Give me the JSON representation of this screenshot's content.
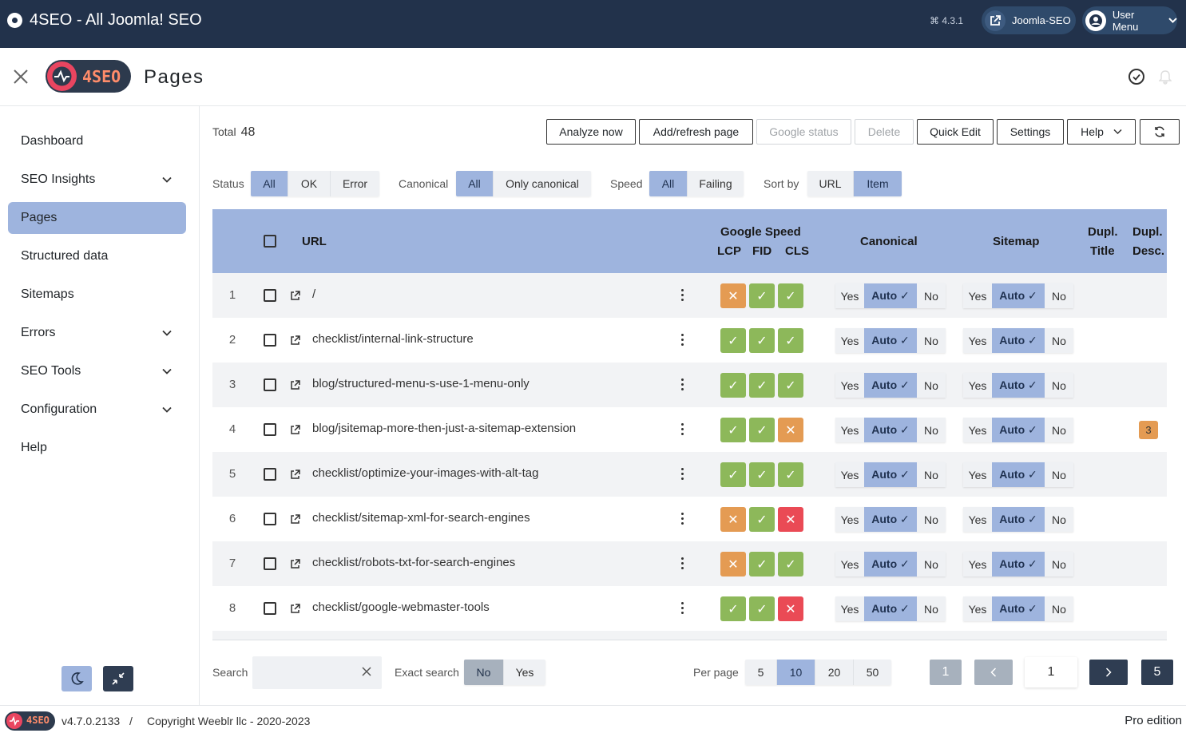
{
  "topbar": {
    "title": "4SEO - All Joomla! SEO",
    "version": "4.3.1",
    "site_button": "Joomla-SEO",
    "user_menu": "User Menu"
  },
  "header": {
    "page_title": "Pages",
    "logo_text": "4SEO"
  },
  "sidebar": {
    "items": [
      {
        "label": "Dashboard",
        "has_chevron": false,
        "active": false
      },
      {
        "label": "SEO Insights",
        "has_chevron": true,
        "active": false
      },
      {
        "label": "Pages",
        "has_chevron": false,
        "active": true
      },
      {
        "label": "Structured data",
        "has_chevron": false,
        "active": false
      },
      {
        "label": "Sitemaps",
        "has_chevron": false,
        "active": false
      },
      {
        "label": "Errors",
        "has_chevron": true,
        "active": false
      },
      {
        "label": "SEO Tools",
        "has_chevron": true,
        "active": false
      },
      {
        "label": "Configuration",
        "has_chevron": true,
        "active": false
      },
      {
        "label": "Help",
        "has_chevron": false,
        "active": false
      }
    ]
  },
  "toolbar": {
    "total_label": "Total",
    "total_value": "48",
    "analyze": "Analyze now",
    "add_refresh": "Add/refresh page",
    "google_status": "Google status",
    "delete": "Delete",
    "quick_edit": "Quick Edit",
    "settings": "Settings",
    "help": "Help"
  },
  "filters": {
    "status_label": "Status",
    "status_all": "All",
    "status_ok": "OK",
    "status_error": "Error",
    "canonical_label": "Canonical",
    "canonical_all": "All",
    "canonical_only": "Only canonical",
    "speed_label": "Speed",
    "speed_all": "All",
    "speed_failing": "Failing",
    "sort_label": "Sort by",
    "sort_url": "URL",
    "sort_item": "Item"
  },
  "table": {
    "headers": {
      "url": "URL",
      "google_speed": "Google Speed",
      "lcp": "LCP",
      "fid": "FID",
      "cls": "CLS",
      "canonical": "Canonical",
      "sitemap": "Sitemap",
      "dupl_title_1": "Dupl.",
      "dupl_title_2": "Title",
      "dupl_desc_1": "Dupl.",
      "dupl_desc_2": "Desc."
    },
    "toggle_yes": "Yes",
    "toggle_auto": "Auto ✓",
    "toggle_no": "No",
    "rows": [
      {
        "num": "1",
        "url": "/",
        "speed": [
          "warn",
          "ok",
          "ok"
        ],
        "dupl_desc": ""
      },
      {
        "num": "2",
        "url": "checklist/internal-link-structure",
        "speed": [
          "ok",
          "ok",
          "ok"
        ],
        "dupl_desc": ""
      },
      {
        "num": "3",
        "url": "blog/structured-menu-s-use-1-menu-only",
        "speed": [
          "ok",
          "ok",
          "ok"
        ],
        "dupl_desc": ""
      },
      {
        "num": "4",
        "url": "blog/jsitemap-more-then-just-a-sitemap-extension",
        "speed": [
          "ok",
          "ok",
          "warn"
        ],
        "dupl_desc": "3"
      },
      {
        "num": "5",
        "url": "checklist/optimize-your-images-with-alt-tag",
        "speed": [
          "ok",
          "ok",
          "ok"
        ],
        "dupl_desc": ""
      },
      {
        "num": "6",
        "url": "checklist/sitemap-xml-for-search-engines",
        "speed": [
          "warn",
          "ok",
          "bad"
        ],
        "dupl_desc": ""
      },
      {
        "num": "7",
        "url": "checklist/robots-txt-for-search-engines",
        "speed": [
          "warn",
          "ok",
          "ok"
        ],
        "dupl_desc": ""
      },
      {
        "num": "8",
        "url": "checklist/google-webmaster-tools",
        "speed": [
          "ok",
          "ok",
          "bad"
        ],
        "dupl_desc": ""
      }
    ]
  },
  "bottom": {
    "search_label": "Search",
    "search_value": "",
    "exact_label": "Exact search",
    "exact_no": "No",
    "exact_yes": "Yes",
    "per_page_label": "Per page",
    "per_page_options": [
      "5",
      "10",
      "20",
      "50"
    ],
    "per_page_selected": "10",
    "first_page": "1",
    "current_page": "1",
    "last_page": "5"
  },
  "footer": {
    "logo_text": "4SEO",
    "version": "v4.7.0.2133",
    "separator": "/",
    "copyright": "Copyright Weeblr llc - 2020-2023",
    "edition": "Pro edition"
  },
  "colors": {
    "topbar": "#22324b",
    "accent": "#9eb4de",
    "ok": "#8db85a",
    "warn": "#e49b53",
    "bad": "#ea4a55"
  }
}
